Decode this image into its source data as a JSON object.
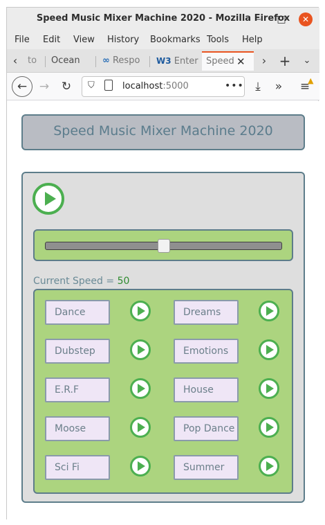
{
  "window": {
    "title": "Speed Music Mixer Machine 2020 - Mozilla Firefox"
  },
  "menu": [
    "File",
    "Edit",
    "View",
    "History",
    "Bookmarks",
    "Tools",
    "Help"
  ],
  "tabs": [
    {
      "label": "to",
      "icon": "page-icon"
    },
    {
      "label": "Ocean",
      "icon": ""
    },
    {
      "label": "Respo",
      "icon": "infinity-icon"
    },
    {
      "label": "Enter",
      "icon": "w3-icon",
      "icon_text": "W3"
    },
    {
      "label": "Speed",
      "icon": "",
      "active": true
    }
  ],
  "nav": {
    "url_host": "localhost",
    "url_port": ":5000"
  },
  "app": {
    "title": "Speed Music Mixer Machine 2020",
    "speed_label": "Current Speed = ",
    "speed_value": "50",
    "speed_fraction": 0.5
  },
  "songs": [
    "Dance",
    "Dreams",
    "Dubstep",
    "Emotions",
    "E.R.F",
    "House",
    "Moose",
    "Pop Dance",
    "Sci Fi",
    "Summer"
  ],
  "colors": {
    "accent": "#4caf50",
    "panel_green": "#acd47f",
    "border": "#5d7d8a",
    "close": "#e95420"
  }
}
